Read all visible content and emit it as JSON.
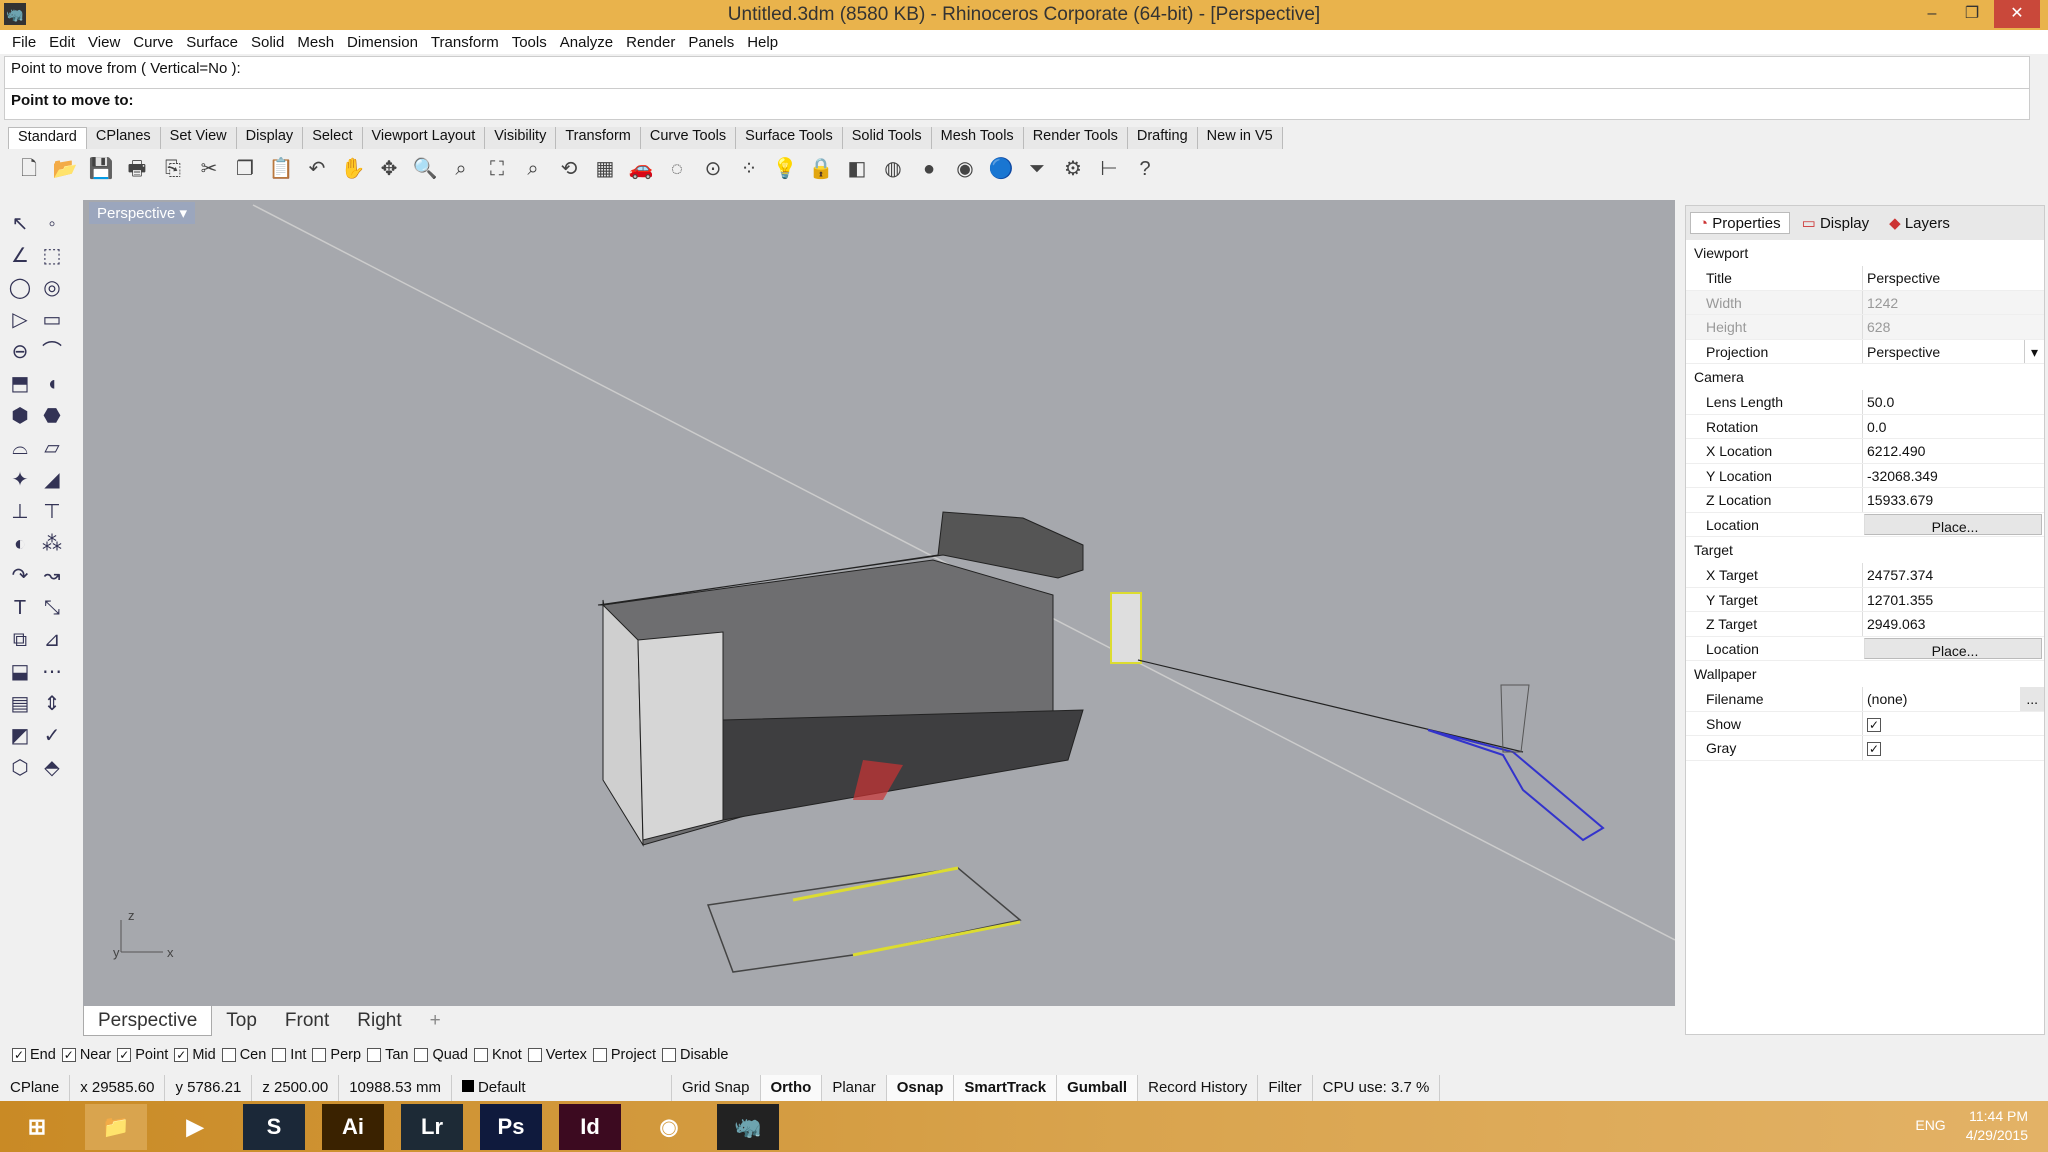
{
  "window": {
    "title": "Untitled.3dm (8580 KB) - Rhinoceros Corporate (64-bit) - [Perspective]"
  },
  "menu": [
    "File",
    "Edit",
    "View",
    "Curve",
    "Surface",
    "Solid",
    "Mesh",
    "Dimension",
    "Transform",
    "Tools",
    "Analyze",
    "Render",
    "Panels",
    "Help"
  ],
  "command": {
    "history": "Point to move from ( Vertical=No ):",
    "prompt": "Point to move to:"
  },
  "toolbar_tabs": [
    "Standard",
    "CPlanes",
    "Set View",
    "Display",
    "Select",
    "Viewport Layout",
    "Visibility",
    "Transform",
    "Curve Tools",
    "Surface Tools",
    "Solid Tools",
    "Mesh Tools",
    "Render Tools",
    "Drafting",
    "New in V5"
  ],
  "toolbar_icons": [
    "new-icon",
    "open-icon",
    "save-icon",
    "print-icon",
    "import-icon",
    "cut-icon",
    "copy-icon",
    "paste-icon",
    "undo-icon",
    "pan-icon",
    "rotate-view-icon",
    "zoom-icon",
    "zoom-window-icon",
    "zoom-extents-icon",
    "zoom-selected-icon",
    "rotate-icon",
    "viewport-layout-icon",
    "car-icon",
    "hide-icon",
    "show-icon",
    "points-icon",
    "light-icon",
    "lock-icon",
    "layer-icon",
    "color-wheel-icon",
    "shaded-icon",
    "rendered-icon",
    "render-icon",
    "filter-icon",
    "options-icon",
    "dimension-icon",
    "help-icon"
  ],
  "viewport": {
    "label": "Perspective",
    "tabs": [
      "Perspective",
      "Top",
      "Front",
      "Right"
    ],
    "add_tab": "+",
    "axes": {
      "x": "x",
      "y": "y",
      "z": "z"
    }
  },
  "panel": {
    "tabs": [
      "Properties",
      "Display",
      "Layers"
    ],
    "sections": [
      {
        "title": "Viewport",
        "rows": [
          {
            "k": "Title",
            "v": "Perspective"
          },
          {
            "k": "Width",
            "v": "1242",
            "disabled": true
          },
          {
            "k": "Height",
            "v": "628",
            "disabled": true
          },
          {
            "k": "Projection",
            "v": "Perspective",
            "dropdown": true
          }
        ]
      },
      {
        "title": "Camera",
        "rows": [
          {
            "k": "Lens Length",
            "v": "50.0"
          },
          {
            "k": "Rotation",
            "v": "0.0"
          },
          {
            "k": "X Location",
            "v": "6212.490"
          },
          {
            "k": "Y Location",
            "v": "-32068.349"
          },
          {
            "k": "Z Location",
            "v": "15933.679"
          },
          {
            "k": "Location",
            "v": "Place...",
            "button": true
          }
        ]
      },
      {
        "title": "Target",
        "rows": [
          {
            "k": "X Target",
            "v": "24757.374"
          },
          {
            "k": "Y Target",
            "v": "12701.355"
          },
          {
            "k": "Z Target",
            "v": "2949.063"
          },
          {
            "k": "Location",
            "v": "Place...",
            "button": true
          }
        ]
      },
      {
        "title": "Wallpaper",
        "rows": [
          {
            "k": "Filename",
            "v": "(none)"
          },
          {
            "k": "Show",
            "v": "",
            "checked": true
          },
          {
            "k": "Gray",
            "v": "",
            "checked": true
          }
        ]
      }
    ]
  },
  "osnap": [
    {
      "l": "End",
      "c": true
    },
    {
      "l": "Near",
      "c": true
    },
    {
      "l": "Point",
      "c": true
    },
    {
      "l": "Mid",
      "c": true
    },
    {
      "l": "Cen",
      "c": false
    },
    {
      "l": "Int",
      "c": false
    },
    {
      "l": "Perp",
      "c": false
    },
    {
      "l": "Tan",
      "c": false
    },
    {
      "l": "Quad",
      "c": false
    },
    {
      "l": "Knot",
      "c": false
    },
    {
      "l": "Vertex",
      "c": false
    },
    {
      "l": "Project",
      "c": false
    },
    {
      "l": "Disable",
      "c": false
    }
  ],
  "status": {
    "cplane": "CPlane",
    "x": "x 29585.60",
    "y": "y 5786.21",
    "z": "z 2500.00",
    "dist": "10988.53 mm",
    "layer": "Default",
    "toggles": [
      {
        "l": "Grid Snap",
        "b": false
      },
      {
        "l": "Ortho",
        "b": true
      },
      {
        "l": "Planar",
        "b": false
      },
      {
        "l": "Osnap",
        "b": true
      },
      {
        "l": "SmartTrack",
        "b": true
      },
      {
        "l": "Gumball",
        "b": true
      },
      {
        "l": "Record History",
        "b": false
      },
      {
        "l": "Filter",
        "b": false
      }
    ],
    "cpu": "CPU use: 3.7 %"
  },
  "taskbar": {
    "apps": [
      {
        "n": "start",
        "t": "⊞",
        "c": "transparent"
      },
      {
        "n": "file-explorer",
        "t": "📁",
        "c": "#d9a44e"
      },
      {
        "n": "media-player",
        "t": "▶",
        "c": "transparent"
      },
      {
        "n": "steam",
        "t": "S",
        "c": "#1b2838"
      },
      {
        "n": "illustrator",
        "t": "Ai",
        "c": "#3a2200"
      },
      {
        "n": "lightroom",
        "t": "Lr",
        "c": "#1d2a36"
      },
      {
        "n": "photoshop",
        "t": "Ps",
        "c": "#0f1a3d"
      },
      {
        "n": "indesign",
        "t": "Id",
        "c": "#3c0a20"
      },
      {
        "n": "chrome",
        "t": "◉",
        "c": "transparent"
      },
      {
        "n": "rhino",
        "t": "🦏",
        "c": "#222"
      }
    ],
    "lang": "ENG",
    "time": "11:44 PM",
    "date": "4/29/2015"
  }
}
